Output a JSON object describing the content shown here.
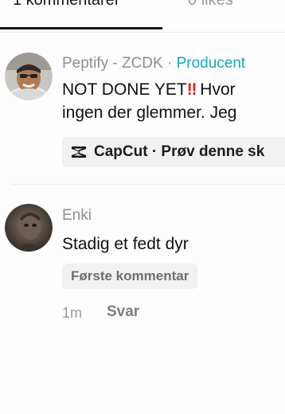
{
  "tabs": {
    "comments_label": "1 kommentarer",
    "likes_label": "0 likes"
  },
  "comments": [
    {
      "author": "Peptify - ZCDK",
      "separator": " · ",
      "role": "Producent",
      "text_line1": "NOT DONE YET",
      "emoji": "‼",
      "text_line1_rest": " Hvor",
      "text_line2": "ingen der glemmer. Jeg",
      "chip_icon": "capcut-icon",
      "chip_label": "CapCut · Prøv denne sk"
    },
    {
      "author": "Enki",
      "text": "Stadig et fedt dyr",
      "badge": "Første kommentar",
      "time": "1m",
      "reply_label": "Svar"
    }
  ],
  "colors": {
    "accent_producer": "#19a6b8",
    "emoji_red": "#e21c1c",
    "muted": "#8d8d8d"
  }
}
